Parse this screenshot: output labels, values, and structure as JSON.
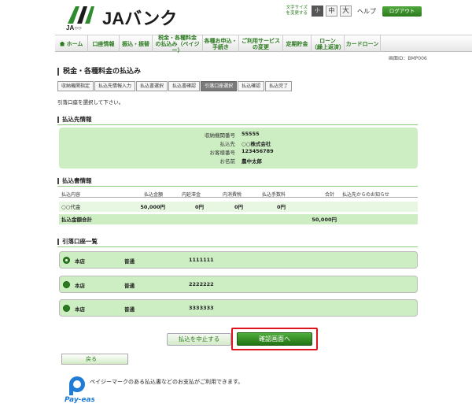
{
  "header": {
    "logo_text": "JAバンク",
    "logo_sub": "JA○○",
    "font_size_label": "文字サイズを変更する",
    "font_size_options": [
      "小",
      "中",
      "大"
    ],
    "help_label": "ヘルプ",
    "logout_label": "ログアウト"
  },
  "nav": {
    "items": [
      "ホーム",
      "口座情報",
      "振込・振替",
      "税金・各種料金の払込み（ペイジー）",
      "各種お申込・手続き",
      "ご利用サービスの変更",
      "定期貯金",
      "ローン（繰上返済）",
      "カードローン"
    ],
    "lines": [
      [
        "ホーム"
      ],
      [
        "口座情報"
      ],
      [
        "振込・振替"
      ],
      [
        "税金・各種料金",
        "の払込み（ペイジー）"
      ],
      [
        "各種お申込・",
        "手続き"
      ],
      [
        "ご利用サービス",
        "の変更"
      ],
      [
        "定期貯金"
      ],
      [
        "ローン",
        "（繰上返済）"
      ],
      [
        "カードローン"
      ]
    ]
  },
  "screen_id": "画面ID：BMP006",
  "page": {
    "title": "税金・各種料金の払込み",
    "steps": [
      "収納機関指定",
      "払込先情報入力",
      "払込書選択",
      "払込書確認",
      "引落口座選択",
      "払込確認",
      "払込完了"
    ],
    "active_step": 4,
    "instruction": "引落口座を選択して下さい。"
  },
  "payee": {
    "heading": "払込先情報",
    "rows": [
      {
        "label": "収納機関番号",
        "value": "55555"
      },
      {
        "label": "払込先",
        "value": "○○株式会社"
      },
      {
        "label": "お客様番号",
        "value": "123456789"
      },
      {
        "label": "お名前",
        "value": "農中太郎"
      }
    ]
  },
  "payment": {
    "heading": "払込書情報",
    "columns": [
      "払込内容",
      "払込金額",
      "内延滞金",
      "内消費税",
      "払込手数料",
      "合計",
      "払込先からのお知らせ"
    ],
    "rows": [
      {
        "content": "○○代金",
        "amount": "50,000円",
        "late_fee": "0円",
        "tax": "0円",
        "fee": "0円",
        "total": "",
        "notice": ""
      }
    ],
    "total_label": "払込金額合計",
    "total_value": "50,000円"
  },
  "accounts": {
    "heading": "引落口座一覧",
    "items": [
      {
        "branch": "本店",
        "type": "普通",
        "number": "1111111",
        "selected": true
      },
      {
        "branch": "本店",
        "type": "普通",
        "number": "2222222",
        "selected": false
      },
      {
        "branch": "本店",
        "type": "普通",
        "number": "3333333",
        "selected": false
      }
    ]
  },
  "buttons": {
    "cancel": "払込を中止する",
    "confirm": "確認画面へ",
    "back": "戻る"
  },
  "footer": {
    "payeasy_logo": "Pay-easy",
    "payeasy_text": "ペイジーマークのある払込書などのお支払がご利用できます。"
  },
  "colors": {
    "brand_green": "#2b7a1f",
    "light_green": "#cdeec3",
    "highlight_red": "#e0141c"
  }
}
